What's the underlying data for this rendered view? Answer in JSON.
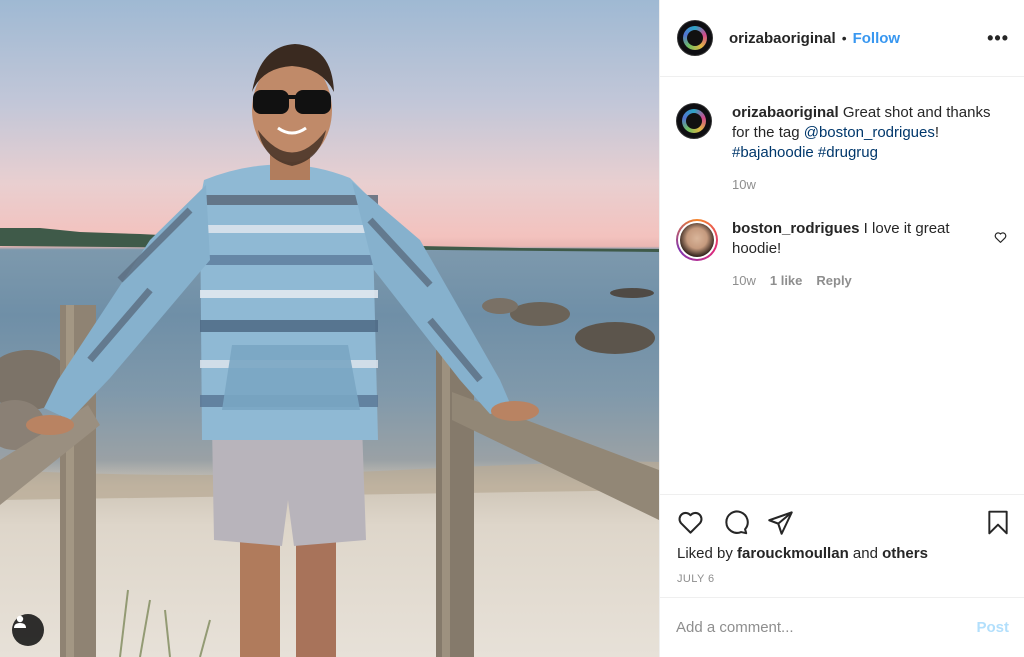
{
  "post": {
    "image_alt": "Man in a striped hoodie standing by wooden railing on a beach at sunset",
    "author": "orizabaoriginal",
    "follow_label": "Follow",
    "dot": "•",
    "more_label": "•••"
  },
  "comments": [
    {
      "username": "orizabaoriginal",
      "text_before_link": " Great shot and thanks for the tag ",
      "mention": "@boston_rodrigues",
      "text_after_link": "!",
      "hashtag1": "#bajahoodie",
      "hashtag2": "#drugrug",
      "time": "10w"
    },
    {
      "username": "boston_rodrigues",
      "text": " I love it great hoodie!",
      "time": "10w",
      "likes": "1 like",
      "reply_label": "Reply"
    }
  ],
  "footer": {
    "liked_by_prefix": "Liked by ",
    "liked_by_user": "farouckmoullan",
    "liked_by_join": " and ",
    "liked_by_others": "others",
    "date": "JULY 6",
    "add_comment_placeholder": "Add a comment...",
    "post_label": "Post"
  },
  "colors": {
    "follow": "#3897f0",
    "link": "#00376b",
    "post_disabled": "#b2dffc",
    "muted": "#8e8e8e"
  },
  "icons": [
    "heart-icon",
    "comment-icon",
    "share-icon",
    "bookmark-icon",
    "user-tag-icon",
    "more-options-icon"
  ]
}
